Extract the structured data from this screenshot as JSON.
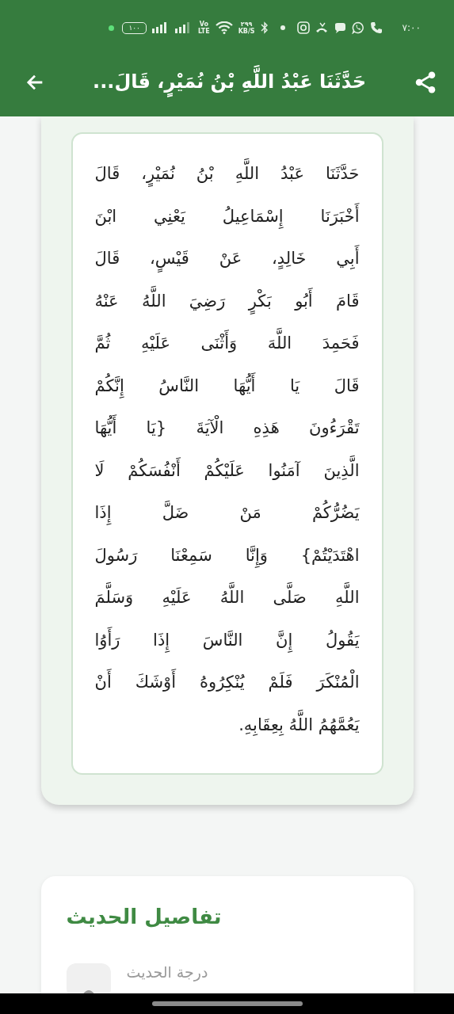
{
  "status_bar": {
    "time": "٧:٠٠",
    "network_speed": "٢٩٩",
    "speed_unit": "KB/S",
    "volte": "Vo",
    "lte": "LTE",
    "battery": "١٠٠"
  },
  "app_bar": {
    "title": "حَدَّثَنَا عَبْدُ اللَّهِ بْنُ نُمَيْرٍ، قَالَ..."
  },
  "hadith_lines": [
    "حَدَّثَنَا عَبْدُ اللَّهِ بْنُ نُمَيْرٍ، قَالَ",
    "أَخْبَرَنَا إِسْمَاعِيلُ يَعْنِي ابْنَ",
    "أَبِي خَالِدٍ، عَنْ قَيْسٍ، قَالَ",
    "قَامَ أَبُو بَكْرٍ رَضِيَ اللَّهُ عَنْهُ",
    "فَحَمِدَ اللَّهَ وَأَثْنَى عَلَيْهِ ثُمَّ",
    "قَالَ يَا أَيُّهَا النَّاسُ إِنَّكُمْ",
    "تَقْرَءُونَ هَذِهِ الْآيَةَ {يَا أَيُّهَا",
    "الَّذِينَ آمَنُوا عَلَيْكُمْ أَنْفُسَكُمْ لَا",
    "يَضُرُّكُمْ مَنْ ضَلَّ إِذَا",
    "اهْتَدَيْتُمْ} وَإِنَّا سَمِعْنَا رَسُولَ",
    "اللَّهِ صَلَّى اللَّهُ عَلَيْهِ وَسَلَّمَ",
    "يَقُولُ إِنَّ النَّاسَ إِذَا رَأَوُا",
    "الْمُنْكَرَ فَلَمْ يُنْكِرُوهُ أَوْشَكَ أَنْ",
    "يَعُمَّهُمُ اللَّهُ بِعِقَابِهِ."
  ],
  "details": {
    "title": "تفاصيل الحديث",
    "rows": [
      {
        "label": "درجة الحديث"
      }
    ]
  }
}
